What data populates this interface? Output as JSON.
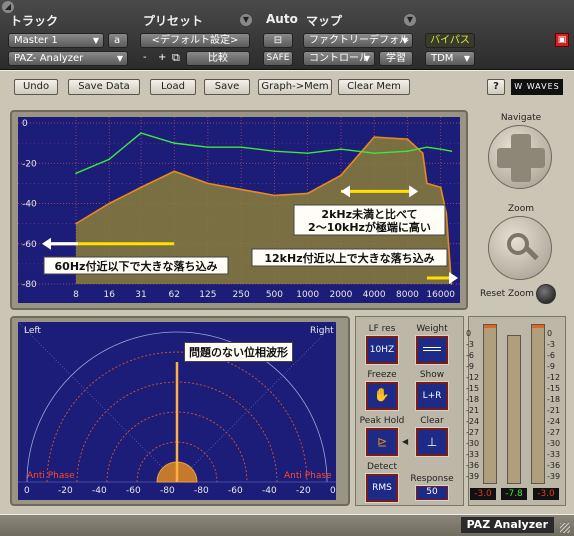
{
  "host": {
    "headers": {
      "track": "トラック",
      "preset": "プリセット",
      "auto": "Auto",
      "map": "マップ"
    },
    "track_name": "Master 1",
    "track_channel": "a",
    "plugin_name": "PAZ- Analyzer",
    "preset_value": "<デフォルト設定>",
    "minus": "-",
    "plus": "+",
    "compare": "比較",
    "safe": "SAFE",
    "map_value": "ファクトリーデフォル",
    "bypass": "バイパス",
    "controller": "コントロール",
    "learn": "学習",
    "tdm": "TDM"
  },
  "toolbar": {
    "undo": "Undo",
    "save_data": "Save Data",
    "load": "Load",
    "save": "Save",
    "graph_mem": "Graph->Mem",
    "clear_mem": "Clear Mem",
    "help": "?",
    "brand": "WAVES"
  },
  "navigate": {
    "label": "Navigate",
    "zoom": "Zoom",
    "reset_zoom": "Reset Zoom"
  },
  "chart_data": {
    "type": "area",
    "x_scale": "log",
    "x_ticks": [
      "8",
      "16",
      "31",
      "62",
      "125",
      "250",
      "500",
      "1000",
      "2000",
      "4000",
      "8000",
      "16000"
    ],
    "y_ticks": [
      "0",
      "-20",
      "-40",
      "-60",
      "-80"
    ],
    "ylim": [
      -80,
      0
    ],
    "series": [
      {
        "color": "#3ee63e",
        "x": [
          8,
          16,
          31,
          62,
          125,
          250,
          500,
          1000,
          2000,
          4000,
          8000,
          12000,
          16000,
          20000
        ],
        "y": [
          -25,
          -18,
          -5,
          -10,
          -12,
          -12,
          -14,
          -15,
          -13,
          -15,
          -14,
          -12,
          -13,
          -14
        ]
      },
      {
        "color": "#e68a1e",
        "x": [
          8,
          16,
          31,
          62,
          125,
          250,
          500,
          1000,
          2000,
          4000,
          8000,
          11000,
          12000,
          16000,
          18000,
          20000
        ],
        "y": [
          -50,
          -40,
          -32,
          -24,
          -30,
          -33,
          -36,
          -35,
          -26,
          -7,
          -8,
          -15,
          -30,
          -32,
          -45,
          -80
        ]
      }
    ],
    "annotations": [
      "60Hz付近以下で大きな落ち込み",
      "2kHz未満と比べて\n2〜10kHzが極端に高い",
      "12kHz付近以上で大きな落ち込み"
    ]
  },
  "phase": {
    "left": "Left",
    "right": "Right",
    "anti_left": "Anti Phase",
    "anti_right": "Anti Phase",
    "annotation": "問題のない位相波形",
    "ticks": [
      "0",
      "-20",
      "-40",
      "-60",
      "-80",
      "-80",
      "-60",
      "-40",
      "-20",
      "0"
    ]
  },
  "controls": {
    "lf_res": "LF res",
    "lf_res_value": "10HZ",
    "weight": "Weight",
    "freeze": "Freeze",
    "show": "Show",
    "show_value": "L+R",
    "peak_hold": "Peak Hold",
    "clear": "Clear",
    "detect": "Detect",
    "detect_value": "RMS",
    "response": "Response",
    "response_value": "50"
  },
  "meters": {
    "scale": [
      "0",
      "-3",
      "-6",
      "-9",
      "-12",
      "-15",
      "-18",
      "-21",
      "-24",
      "-27",
      "-30",
      "-33",
      "-36",
      "-39"
    ],
    "left_value": "-3.0",
    "center_value": "-7.8",
    "right_value": "-3.0"
  },
  "footer": {
    "title": "PAZ Analyzer"
  }
}
